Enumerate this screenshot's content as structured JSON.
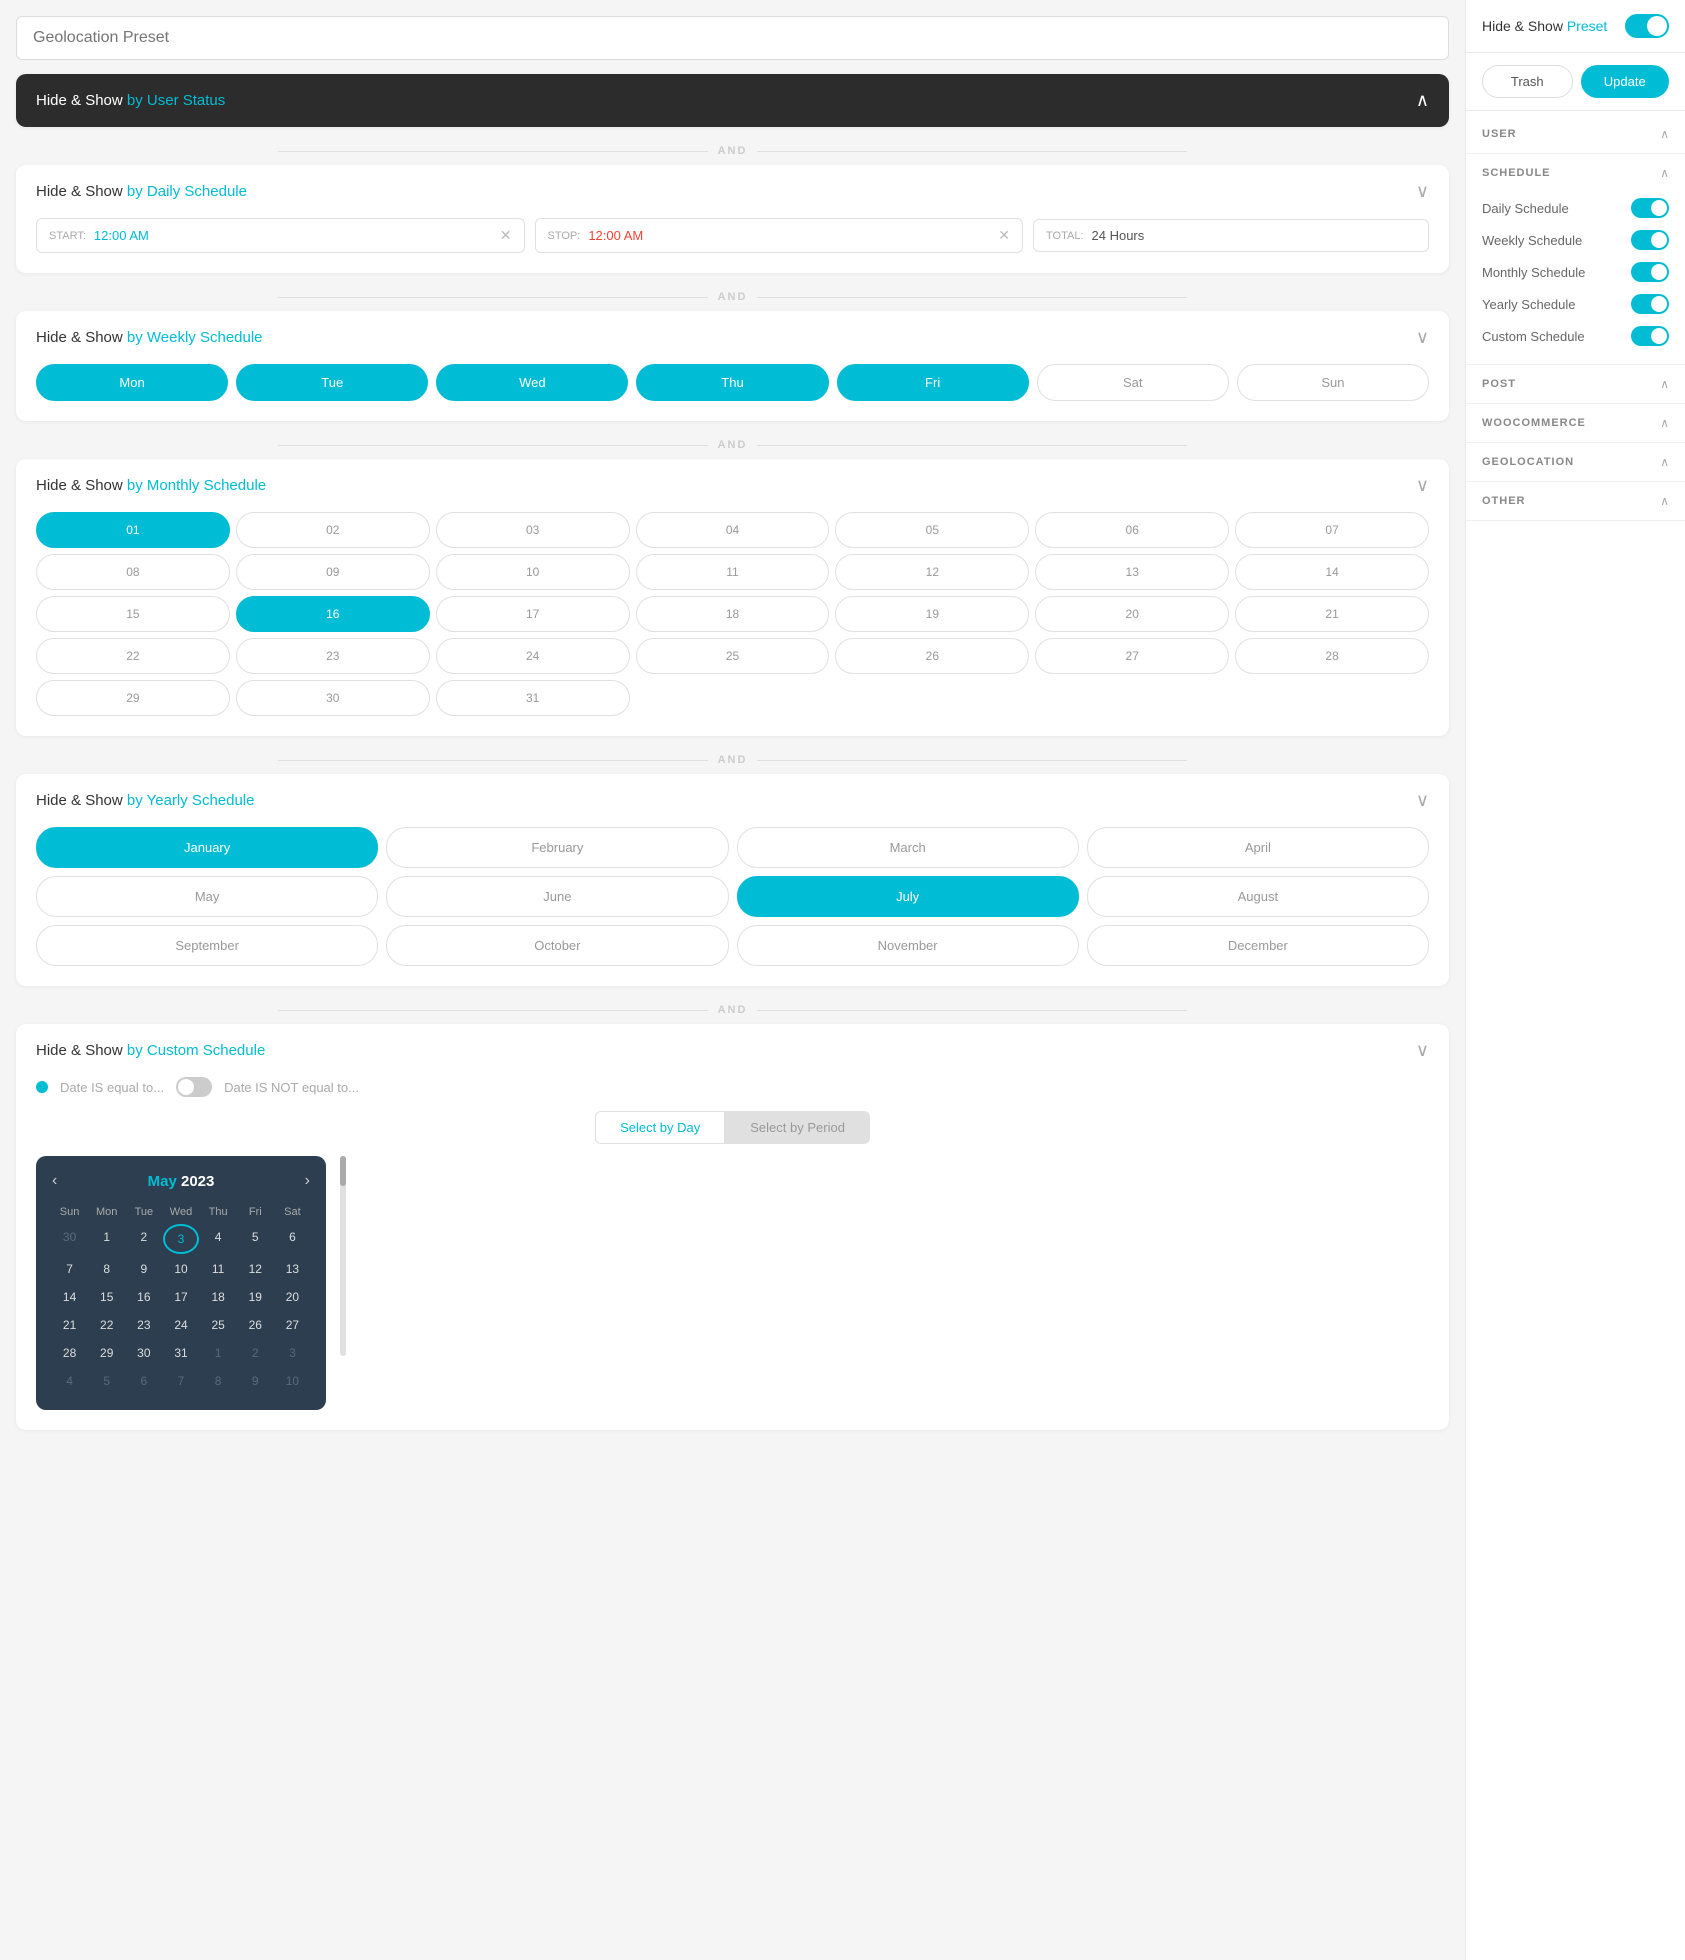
{
  "left": {
    "preset_title": "Geolocation Preset",
    "preset_placeholder": "Geolocation Preset",
    "user_status": {
      "label": "Hide & Show ",
      "accent": "by User Status"
    },
    "daily": {
      "title_prefix": "Hide & Show ",
      "title_accent": "by Daily Schedule",
      "start_label": "START:",
      "start_value": "12:00 AM",
      "stop_label": "STOP:",
      "stop_value": "12:00 AM",
      "total_label": "TOTAL:",
      "total_value": "24 Hours"
    },
    "and_label": "AND",
    "weekly": {
      "title_prefix": "Hide & Show ",
      "title_accent": "by Weekly Schedule",
      "days": [
        {
          "label": "Mon",
          "active": true
        },
        {
          "label": "Tue",
          "active": true
        },
        {
          "label": "Wed",
          "active": true
        },
        {
          "label": "Thu",
          "active": true
        },
        {
          "label": "Fri",
          "active": true
        },
        {
          "label": "Sat",
          "active": false
        },
        {
          "label": "Sun",
          "active": false
        }
      ]
    },
    "monthly": {
      "title_prefix": "Hide & Show ",
      "title_accent": "by Monthly Schedule",
      "days": [
        {
          "num": "01",
          "active": true
        },
        {
          "num": "02",
          "active": false
        },
        {
          "num": "03",
          "active": false
        },
        {
          "num": "04",
          "active": false
        },
        {
          "num": "05",
          "active": false
        },
        {
          "num": "06",
          "active": false
        },
        {
          "num": "07",
          "active": false
        },
        {
          "num": "08",
          "active": false
        },
        {
          "num": "09",
          "active": false
        },
        {
          "num": "10",
          "active": false
        },
        {
          "num": "11",
          "active": false
        },
        {
          "num": "12",
          "active": false
        },
        {
          "num": "13",
          "active": false
        },
        {
          "num": "14",
          "active": false
        },
        {
          "num": "15",
          "active": false
        },
        {
          "num": "16",
          "active": true
        },
        {
          "num": "17",
          "active": false
        },
        {
          "num": "18",
          "active": false
        },
        {
          "num": "19",
          "active": false
        },
        {
          "num": "20",
          "active": false
        },
        {
          "num": "21",
          "active": false
        },
        {
          "num": "22",
          "active": false
        },
        {
          "num": "23",
          "active": false
        },
        {
          "num": "24",
          "active": false
        },
        {
          "num": "25",
          "active": false
        },
        {
          "num": "26",
          "active": false
        },
        {
          "num": "27",
          "active": false
        },
        {
          "num": "28",
          "active": false
        },
        {
          "num": "29",
          "active": false
        },
        {
          "num": "30",
          "active": false
        },
        {
          "num": "31",
          "active": false
        }
      ]
    },
    "yearly": {
      "title_prefix": "Hide & Show ",
      "title_accent": "by Yearly Schedule",
      "months": [
        {
          "label": "January",
          "active": true
        },
        {
          "label": "February",
          "active": false
        },
        {
          "label": "March",
          "active": false
        },
        {
          "label": "April",
          "active": false
        },
        {
          "label": "May",
          "active": false
        },
        {
          "label": "June",
          "active": false
        },
        {
          "label": "July",
          "active": true
        },
        {
          "label": "August",
          "active": false
        },
        {
          "label": "September",
          "active": false
        },
        {
          "label": "October",
          "active": false
        },
        {
          "label": "November",
          "active": false
        },
        {
          "label": "December",
          "active": false
        }
      ]
    },
    "custom": {
      "title_prefix": "Hide & Show ",
      "title_accent": "by Custom Schedule",
      "date_is_equal_label": "Date IS equal to...",
      "date_is_not_label": "Date IS NOT equal to...",
      "select_by_day_label": "Select by Day",
      "select_by_period_label": "Select by Period",
      "calendar": {
        "month": "May",
        "year": "2023",
        "nav_prev": "‹",
        "nav_next": "›",
        "weekdays": [
          "Sun",
          "Mon",
          "Tue",
          "Wed",
          "Thu",
          "Fri",
          "Sat"
        ],
        "prev_month_days": [
          30
        ],
        "days": [
          1,
          2,
          3,
          4,
          5,
          6,
          7,
          8,
          9,
          10,
          11,
          12,
          13,
          14,
          15,
          16,
          17,
          18,
          19,
          20,
          21,
          22,
          23,
          24,
          25,
          26,
          27,
          28,
          29,
          30,
          31
        ],
        "next_month_days": [
          1,
          2,
          3,
          4,
          5,
          6,
          7,
          8,
          9,
          10
        ],
        "today": 3,
        "rows": [
          [
            {
              "d": "30",
              "om": true
            },
            {
              "d": "1"
            },
            {
              "d": "2"
            },
            {
              "d": "3",
              "today": true
            },
            {
              "d": "4"
            },
            {
              "d": "5"
            },
            {
              "d": "6"
            }
          ],
          [
            {
              "d": "7"
            },
            {
              "d": "8"
            },
            {
              "d": "9"
            },
            {
              "d": "10"
            },
            {
              "d": "11"
            },
            {
              "d": "12"
            },
            {
              "d": "13"
            }
          ],
          [
            {
              "d": "14"
            },
            {
              "d": "15"
            },
            {
              "d": "16"
            },
            {
              "d": "17"
            },
            {
              "d": "18"
            },
            {
              "d": "19"
            },
            {
              "d": "20"
            }
          ],
          [
            {
              "d": "21"
            },
            {
              "d": "22"
            },
            {
              "d": "23"
            },
            {
              "d": "24"
            },
            {
              "d": "25"
            },
            {
              "d": "26"
            },
            {
              "d": "27"
            }
          ],
          [
            {
              "d": "28"
            },
            {
              "d": "29"
            },
            {
              "d": "30"
            },
            {
              "d": "31"
            },
            {
              "d": "1",
              "om": true
            },
            {
              "d": "2",
              "om": true
            },
            {
              "d": "3",
              "om": true
            }
          ],
          [
            {
              "d": "4",
              "om": true
            },
            {
              "d": "5",
              "om": true
            },
            {
              "d": "6",
              "om": true
            },
            {
              "d": "7",
              "om": true
            },
            {
              "d": "8",
              "om": true
            },
            {
              "d": "9",
              "om": true
            },
            {
              "d": "10",
              "om": true
            }
          ]
        ]
      }
    }
  },
  "right": {
    "header_title": "Hide & Show ",
    "header_accent": "Preset",
    "trash_label": "Trash",
    "update_label": "Update",
    "sections": [
      {
        "title": "USER",
        "key": "user",
        "expanded": true,
        "items": []
      },
      {
        "title": "SCHEDULE",
        "key": "schedule",
        "expanded": true,
        "items": [
          {
            "label": "Daily Schedule",
            "toggled": true
          },
          {
            "label": "Weekly Schedule",
            "toggled": true
          },
          {
            "label": "Monthly Schedule",
            "toggled": true
          },
          {
            "label": "Yearly Schedule",
            "toggled": true
          },
          {
            "label": "Custom Schedule",
            "toggled": true
          }
        ]
      },
      {
        "title": "POST",
        "key": "post",
        "expanded": true,
        "items": []
      },
      {
        "title": "WOOCOMMERCE",
        "key": "woocommerce",
        "expanded": true,
        "items": []
      },
      {
        "title": "GEOLOCATION",
        "key": "geolocation",
        "expanded": true,
        "items": []
      },
      {
        "title": "OTHER",
        "key": "other",
        "expanded": true,
        "items": []
      }
    ]
  }
}
